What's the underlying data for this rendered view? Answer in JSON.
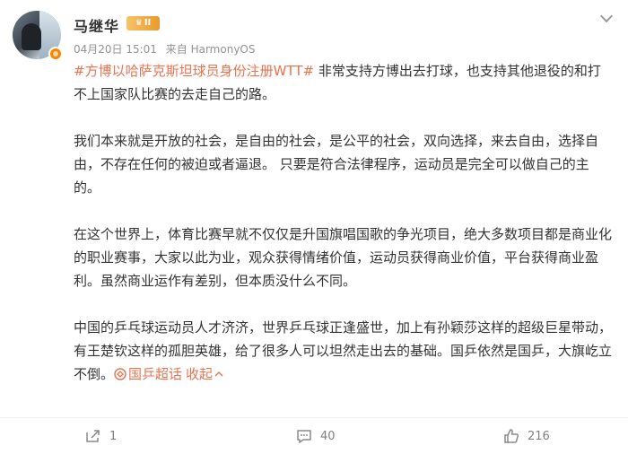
{
  "post": {
    "author": "马继华",
    "level_badge": "II",
    "date": "04月20日 15:01",
    "source": "来自 HarmonyOS",
    "topic": "#方博以哈萨克斯坦球员身份注册WTT#",
    "paragraph1_rest": " 非常支持方博出去打球，也支持其他退役的和打不上国家队比赛的去走自己的路。",
    "paragraph2": "我们本来就是开放的社会，是自由的社会，是公平的社会，双向选择，来去自由，选择自由，不存在任何的被迫或者逼退。 只要是符合法律程序，运动员是完全可以做自己的主的。",
    "paragraph3": "在这个世界上，体育比赛早就不仅仅是升国旗唱国歌的争光项目，绝大多数项目都是商业化的职业赛事，大家以此为业，观众获得情绪价值，运动员获得商业价值，平台获得商业盈利。虽然商业运作有差别，但本质没什么不同。",
    "paragraph4": "中国的乒乓球运动员人才济济，世界乒乓球正逢盛世，加上有孙颖莎这样的超级巨星带动，有王楚钦这样的孤胆英雄，给了很多人可以坦然走出去的基础。国乒依然是国乒，大旗屹立不倒。",
    "super_topic": "国乒超话",
    "collapse_label": "收起"
  },
  "actions": {
    "reposts": "1",
    "comments": "40",
    "likes": "216"
  },
  "colors": {
    "link": "#eb7350",
    "meta": "#939393",
    "text": "#333333"
  },
  "icons": [
    "avatar",
    "verified-badge-icon",
    "chevron-down-icon",
    "super-topic-icon",
    "repost-icon",
    "comment-icon",
    "like-icon"
  ]
}
